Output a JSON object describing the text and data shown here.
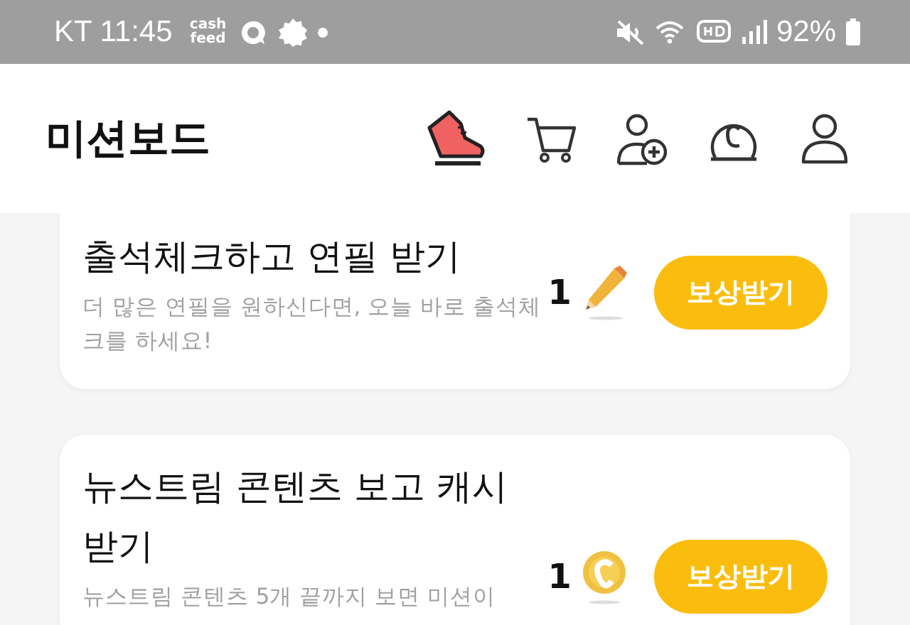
{
  "status_bar": {
    "carrier_time": "KT 11:45",
    "notification_text": "cash feed",
    "battery": "92%"
  },
  "header": {
    "title": "미션보드"
  },
  "missions": [
    {
      "title": "출석체크하고 연필 받기",
      "description": "더 많은 연필을 원하신다면, 오늘 바로 출석체크를 하세요!",
      "reward": "1",
      "kind": "pencil",
      "button": "보상받기"
    },
    {
      "title": "뉴스트림 콘텐츠 보고 캐시 받기",
      "description": "뉴스트림 콘텐츠 5개 끝까지 보면 미션이",
      "reward": "1",
      "kind": "coin",
      "button": "보상받기"
    }
  ]
}
